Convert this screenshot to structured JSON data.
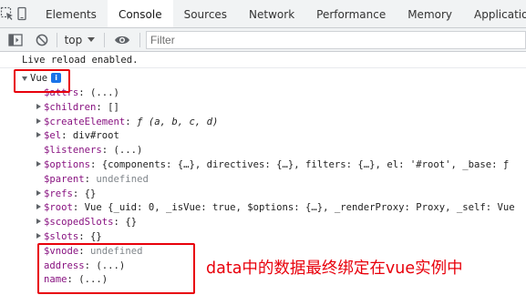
{
  "tabs": [
    {
      "label": "Elements",
      "active": false
    },
    {
      "label": "Console",
      "active": true
    },
    {
      "label": "Sources",
      "active": false
    },
    {
      "label": "Network",
      "active": false
    },
    {
      "label": "Performance",
      "active": false
    },
    {
      "label": "Memory",
      "active": false
    },
    {
      "label": "Application",
      "active": false
    }
  ],
  "toolbar": {
    "context": "top",
    "filter_placeholder": "Filter"
  },
  "icons": {
    "inspect": "cursor-inspect-icon",
    "device": "device-toggle-icon",
    "sidebar": "sidebar-toggle-icon",
    "clear": "clear-console-icon",
    "eye": "live-expression-eye-icon",
    "info": "info-icon"
  },
  "colors": {
    "accent": "#1a73e8",
    "annotation_red": "#e8000b",
    "key_purple": "#881280"
  },
  "console": {
    "message": "Live reload enabled.",
    "root_label": "Vue",
    "info_badge": "i",
    "properties": [
      {
        "key": "$attrs",
        "sep": ": ",
        "value": "(...)",
        "kind": "plain",
        "expandable": false,
        "dim": false
      },
      {
        "key": "$children",
        "sep": ": ",
        "value": "[]",
        "kind": "plain",
        "expandable": true,
        "dim": false
      },
      {
        "key": "$createElement",
        "sep": ": ",
        "value": "ƒ (a, b, c, d)",
        "kind": "fn",
        "expandable": true,
        "dim": false
      },
      {
        "key": "$el",
        "sep": ": ",
        "value": "div#root",
        "kind": "plain",
        "expandable": true,
        "dim": false
      },
      {
        "key": "$listeners",
        "sep": ": ",
        "value": "(...)",
        "kind": "plain",
        "expandable": false,
        "dim": false
      },
      {
        "key": "$options",
        "sep": ": ",
        "value": "{components: {…}, directives: {…}, filters: {…}, el: '#root', _base: ƒ",
        "kind": "plain",
        "expandable": true,
        "dim": false
      },
      {
        "key": "$parent",
        "sep": ": ",
        "value": "undefined",
        "kind": "undef",
        "expandable": false,
        "dim": false
      },
      {
        "key": "$refs",
        "sep": ": ",
        "value": "{}",
        "kind": "plain",
        "expandable": true,
        "dim": false
      },
      {
        "key": "$root",
        "sep": ": ",
        "value": "Vue {_uid: 0, _isVue: true, $options: {…}, _renderProxy: Proxy, _self: Vue",
        "kind": "plain",
        "expandable": true,
        "dim": false
      },
      {
        "key": "$scopedSlots",
        "sep": ": ",
        "value": "{}",
        "kind": "plain",
        "expandable": true,
        "dim": false
      },
      {
        "key": "$slots",
        "sep": ": ",
        "value": "{}",
        "kind": "plain",
        "expandable": true,
        "dim": false
      },
      {
        "key": "$vnode",
        "sep": ": ",
        "value": "undefined",
        "kind": "undef",
        "expandable": false,
        "dim": false
      },
      {
        "key": "address",
        "sep": ": ",
        "value": "(...)",
        "kind": "plain",
        "expandable": false,
        "dim": false
      },
      {
        "key": "name",
        "sep": ": ",
        "value": "(...)",
        "kind": "plain",
        "expandable": false,
        "dim": false
      }
    ]
  },
  "annotation": {
    "text": "data中的数据最终绑定在vue实例中"
  }
}
